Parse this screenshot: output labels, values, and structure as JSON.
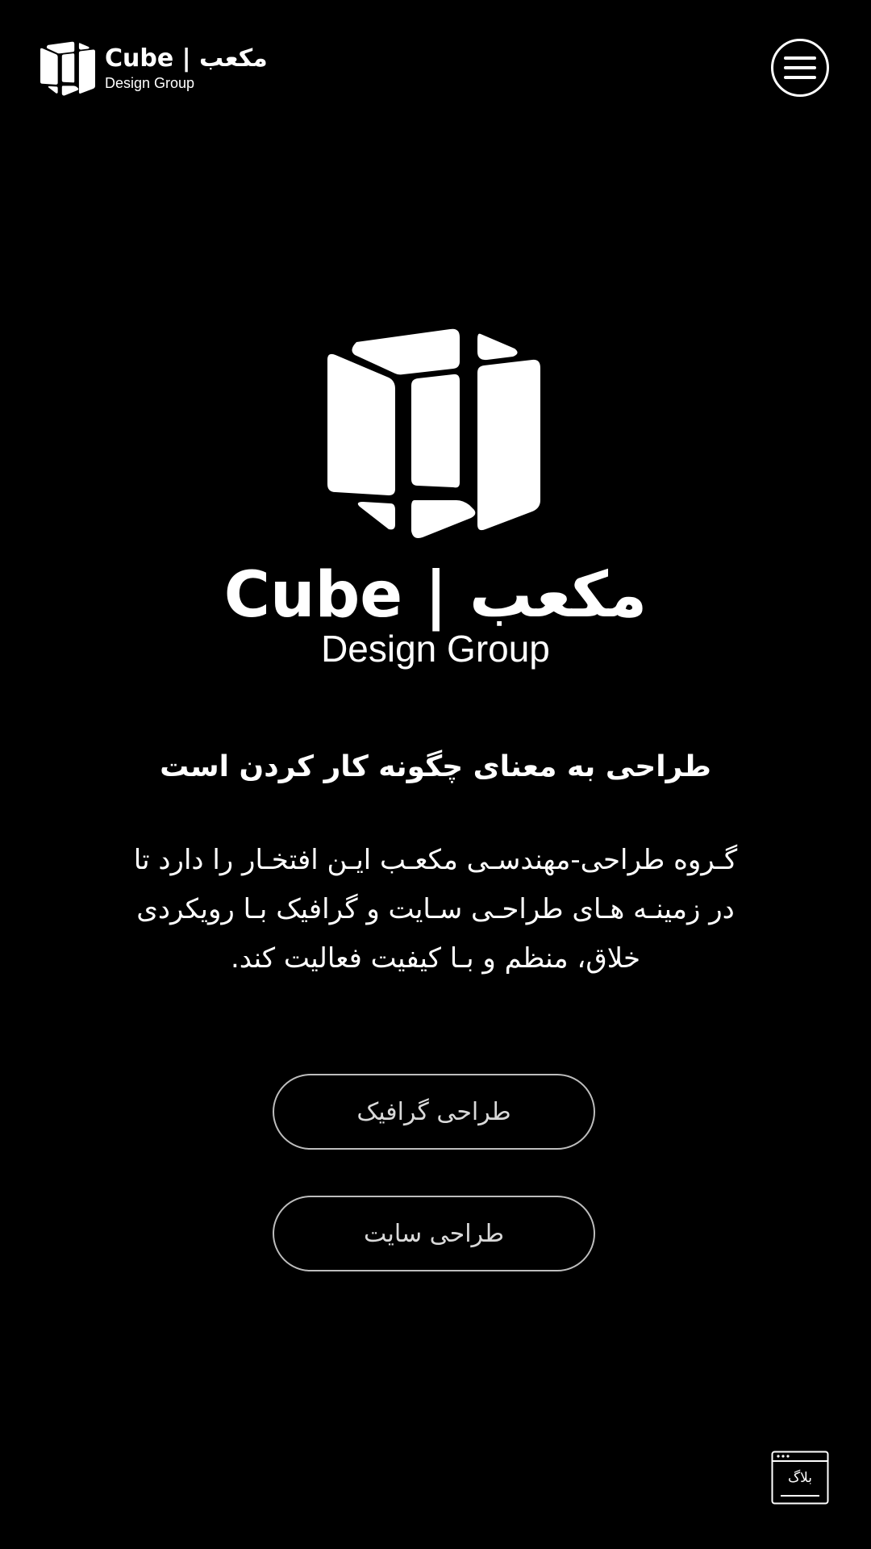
{
  "header": {
    "logo_title": "Cube | مکعب",
    "logo_subtitle": "Design Group",
    "menu_icon": "hamburger-menu-icon"
  },
  "hero": {
    "logo_icon": "cube-logo-icon",
    "title": "Cube | مکعب",
    "subtitle": "Design Group"
  },
  "tagline": "طراحی به معنای چگونه کار کردن است",
  "description": {
    "lines": [
      "گـروه طراحی-مهندسـی مکعـب ایـن افتخـار را دارد تا",
      "در زمینـه هـای طراحـی سـایت و گرافیک بـا رویکردی",
      "خلاق، منظم و بـا کیفیت فعالیت کند."
    ]
  },
  "buttons": {
    "graphic_design": "طراحی گرافیک",
    "site_design": "طراحی سایت"
  },
  "blog": {
    "label": "بلاگ",
    "icon": "browser-window-icon"
  },
  "colors": {
    "background": "#000000",
    "foreground": "#ffffff",
    "button_border": "#bdbdbd"
  }
}
